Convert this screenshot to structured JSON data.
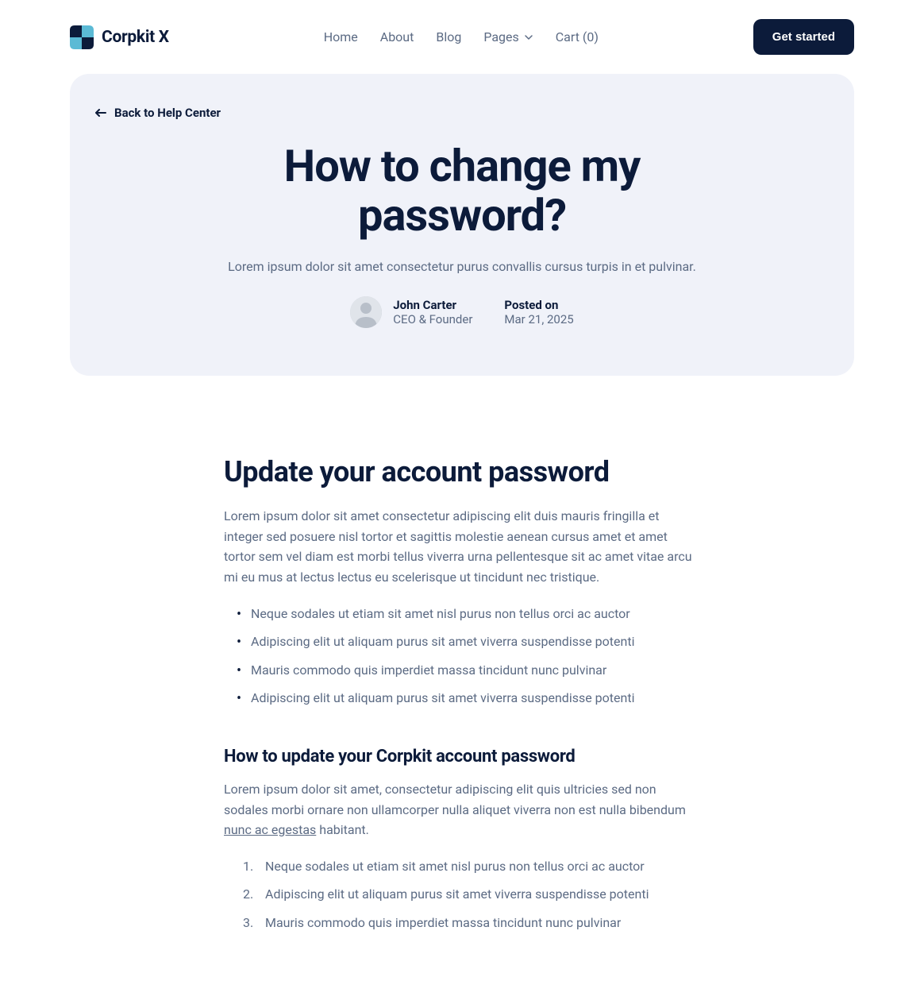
{
  "header": {
    "logo_text": "Corpkit X",
    "nav": {
      "home": "Home",
      "about": "About",
      "blog": "Blog",
      "pages": "Pages",
      "cart": "Cart (0)"
    },
    "cta": "Get started"
  },
  "hero": {
    "back_link": "Back to Help Center",
    "title_line1": "How to change my",
    "title_line2": "password?",
    "subtitle": "Lorem ipsum dolor sit amet consectetur purus convallis cursus turpis in et pulvinar.",
    "author": {
      "name": "John Carter",
      "role": "CEO & Founder"
    },
    "posted": {
      "label": "Posted on",
      "date": "Mar 21, 2025"
    }
  },
  "content": {
    "h2": "Update your account password",
    "p1": "Lorem ipsum dolor sit amet consectetur adipiscing elit duis mauris fringilla et integer sed posuere nisl tortor et sagittis molestie aenean cursus amet et amet tortor sem vel diam est morbi tellus viverra urna pellentesque sit ac amet vitae arcu mi eu mus at lectus lectus eu scelerisque ut tincidunt nec tristique.",
    "ul": [
      "Neque sodales ut etiam sit amet nisl purus non tellus orci ac auctor",
      "Adipiscing elit ut aliquam purus sit amet viverra suspendisse potenti",
      "Mauris commodo quis imperdiet massa tincidunt nunc pulvinar",
      "Adipiscing elit ut aliquam purus sit amet viverra suspendisse potenti"
    ],
    "h3": "How to update your Corpkit account password",
    "p2_pre": "Lorem ipsum dolor sit amet, consectetur adipiscing elit quis ultricies sed non sodales morbi ornare non ullamcorper nulla aliquet viverra non est nulla bibendum ",
    "p2_link": "nunc ac egestas",
    "p2_post": " habitant.",
    "ol": [
      "Neque sodales ut etiam sit amet nisl purus non tellus orci ac auctor",
      "Adipiscing elit ut aliquam purus sit amet viverra suspendisse potenti",
      "Mauris commodo quis imperdiet massa tincidunt nunc pulvinar"
    ]
  }
}
